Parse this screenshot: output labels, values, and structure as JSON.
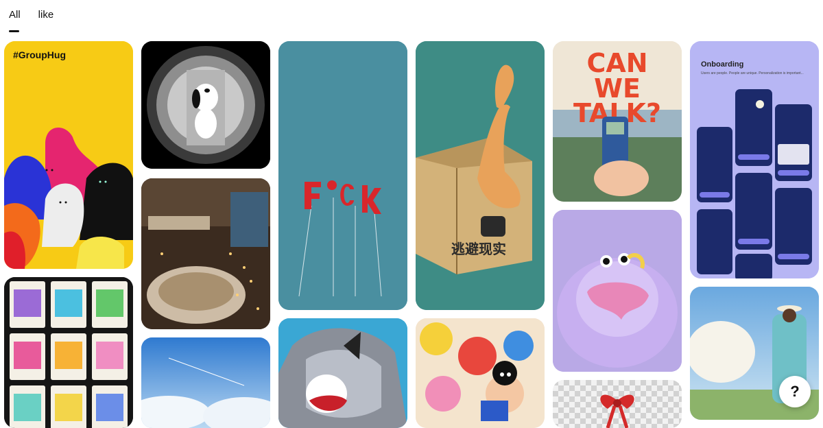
{
  "tabs": [
    {
      "label": "All",
      "active": true
    },
    {
      "label": "like",
      "active": false
    }
  ],
  "pins": {
    "grouphug": {
      "label": "#GroupHug"
    },
    "onboarding": {
      "title": "Onboarding",
      "subtitle": "Users are people. People are unique. Personalization is important..."
    }
  },
  "help": {
    "label": "?"
  },
  "colors": {
    "yellow": "#f7cb15",
    "teal": "#4a8fa0",
    "green": "#3e8c85",
    "lavender": "#b7b6f4"
  }
}
